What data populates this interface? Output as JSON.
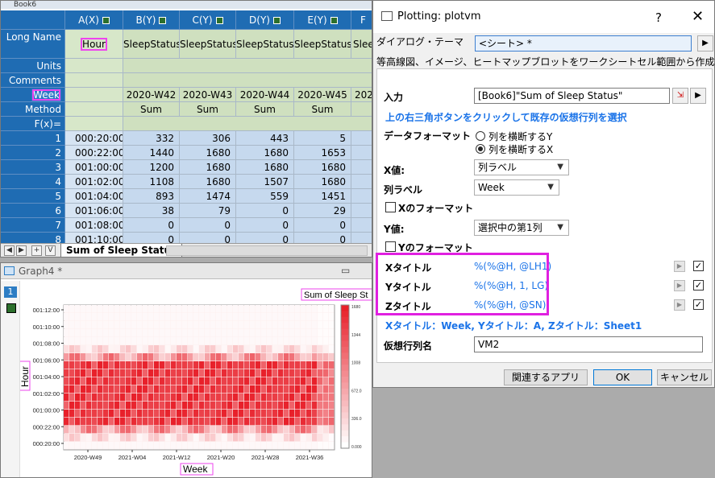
{
  "worksheet": {
    "title": "Book6",
    "columns": [
      {
        "name": "A(X)",
        "long_name": "Hour",
        "week": "",
        "method": ""
      },
      {
        "name": "B(Y)",
        "long_name": "SleepStatus",
        "week": "2020-W42",
        "method": "Sum"
      },
      {
        "name": "C(Y)",
        "long_name": "SleepStatus",
        "week": "2020-W43",
        "method": "Sum"
      },
      {
        "name": "D(Y)",
        "long_name": "SleepStatus",
        "week": "2020-W44",
        "method": "Sum"
      },
      {
        "name": "E(Y)",
        "long_name": "SleepStatus",
        "week": "2020-W45",
        "method": "Sum"
      },
      {
        "name": "F",
        "long_name": "Slee",
        "week": "202",
        "method": "Sum"
      }
    ],
    "row_labels": {
      "long_name": "Long Name",
      "units": "Units",
      "comments": "Comments",
      "week": "Week",
      "method": "Method",
      "fx": "F(x)="
    },
    "rows": [
      {
        "n": "1",
        "cells": [
          "000:20:00",
          "332",
          "306",
          "443",
          "5",
          ""
        ]
      },
      {
        "n": "2",
        "cells": [
          "000:22:00",
          "1440",
          "1680",
          "1680",
          "1653",
          ""
        ]
      },
      {
        "n": "3",
        "cells": [
          "001:00:00",
          "1200",
          "1680",
          "1680",
          "1680",
          ""
        ]
      },
      {
        "n": "4",
        "cells": [
          "001:02:00",
          "1108",
          "1680",
          "1507",
          "1680",
          ""
        ]
      },
      {
        "n": "5",
        "cells": [
          "001:04:00",
          "893",
          "1474",
          "559",
          "1451",
          ""
        ]
      },
      {
        "n": "6",
        "cells": [
          "001:06:00",
          "38",
          "79",
          "0",
          "29",
          ""
        ]
      },
      {
        "n": "7",
        "cells": [
          "001:08:00",
          "0",
          "0",
          "0",
          "0",
          ""
        ]
      },
      {
        "n": "8",
        "cells": [
          "001:10:00",
          "0",
          "0",
          "0",
          "0",
          ""
        ]
      }
    ],
    "nav_buttons": [
      "◀",
      "▶",
      "+",
      "V"
    ],
    "sheet_tab": "Sum of Sleep Status"
  },
  "graph": {
    "title": "Graph4 *",
    "layer": "1",
    "plot_title": "Sum of Sleep St",
    "chart_data": {
      "type": "heatmap",
      "title": "Sum of Sleep St",
      "xlabel": "Week",
      "ylabel": "Hour",
      "x_ticks": [
        "2020-W49",
        "2021-W04",
        "2021-W12",
        "2021-W20",
        "2021-W28",
        "2021-W36"
      ],
      "y_ticks": [
        "000:20:00",
        "000:22:00",
        "001:00:00",
        "001:02:00",
        "001:04:00",
        "001:06:00",
        "001:08:00",
        "001:10:00",
        "001:12:00"
      ],
      "colorbar_ticks": [
        "1680",
        "1344",
        "1008",
        "672.0",
        "336.0",
        "0.000"
      ],
      "colorbar_range": [
        0,
        1680
      ],
      "colors": {
        "low": "#ffffff",
        "high": "#e8202a"
      }
    }
  },
  "dialog": {
    "title": "Plotting: plotvm",
    "help": "?",
    "close": "✕",
    "theme_label": "ダイアログ・テーマ",
    "theme_value": "<シート> *",
    "description": "等高線図、イメージ、ヒートマップブロットをワークシートセル範囲から作成",
    "input_label": "入力",
    "input_value": "[Book6]\"Sum of Sleep Status\"",
    "hint": "上の右三角ボタンをクリックして既存の仮想行列を選択",
    "data_format_label": "データフォーマット",
    "data_format_options": [
      "列を横断するY",
      "列を横断するX"
    ],
    "x_value_label": "X値:",
    "x_value": "列ラベル",
    "col_label_label": "列ラベル",
    "col_label_value": "Week",
    "x_format_label": "Xのフォーマット",
    "y_value_label": "Y値:",
    "y_value": "選択中の第1列",
    "y_format_label": "Yのフォーマット",
    "x_title_label": "Xタイトル",
    "x_title_value": "%(%@H, @LH1)",
    "y_title_label": "Yタイトル",
    "y_title_value": "%(%@H, 1, LG)",
    "z_title_label": "Zタイトル",
    "z_title_value": "%(%@H, @SN)",
    "preview": "Xタイトル：Week, Yタイトル：A, Zタイトル：Sheet1",
    "vm_name_label": "仮想行列名",
    "vm_name_value": "VM2",
    "buttons": {
      "related_apps": "関連するアプリ",
      "ok": "OK",
      "cancel": "キャンセル"
    }
  }
}
